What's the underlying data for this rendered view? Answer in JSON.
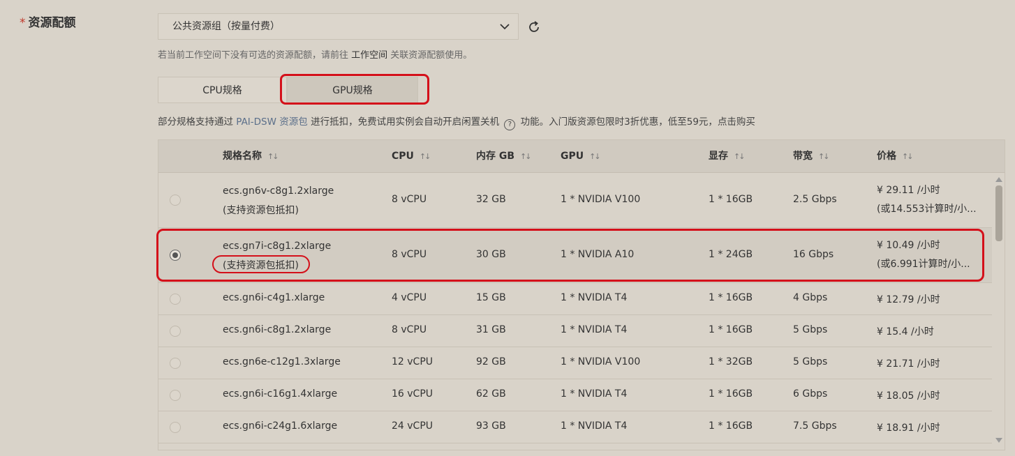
{
  "field": {
    "required_mark": "*",
    "label": "资源配额"
  },
  "select": {
    "value": "公共资源组（按量付费）"
  },
  "hint": {
    "before": "若当前工作空间下没有可选的资源配额，请前往 ",
    "link": "工作空间",
    "after": " 关联资源配额使用。"
  },
  "tabs": [
    {
      "label": "CPU规格"
    },
    {
      "label": "GPU规格"
    }
  ],
  "note": {
    "part1": "部分规格支持通过 ",
    "link1": "PAI-DSW 资源包",
    "part2": " 进行抵扣，免费试用实例会自动开启闲置关机 ",
    "help_icon": "?",
    "part3": " 功能。入门版资源包限时3折优惠，低至59元，",
    "link2": "点击购买"
  },
  "table": {
    "sort_glyph": "↑↓",
    "headers": [
      "规格名称",
      "CPU",
      "内存 GB",
      "GPU",
      "显存",
      "带宽",
      "价格"
    ],
    "rows": [
      {
        "name": "ecs.gn6v-c8g1.2xlarge",
        "sub": "(支持资源包抵扣)",
        "cpu": "8 vCPU",
        "mem": "32 GB",
        "gpu": "1 * NVIDIA V100",
        "vram": "1 * 16GB",
        "bw": "2.5 Gbps",
        "price": "¥ 29.11 /小时",
        "price_sub": "(或14.553计算时/小...",
        "selected": false
      },
      {
        "name": "ecs.gn7i-c8g1.2xlarge",
        "sub": "(支持资源包抵扣)",
        "cpu": "8 vCPU",
        "mem": "30 GB",
        "gpu": "1 * NVIDIA A10",
        "vram": "1 * 24GB",
        "bw": "16 Gbps",
        "price": "¥ 10.49 /小时",
        "price_sub": "(或6.991计算时/小...",
        "selected": true
      },
      {
        "name": "ecs.gn6i-c4g1.xlarge",
        "cpu": "4 vCPU",
        "mem": "15 GB",
        "gpu": "1 * NVIDIA T4",
        "vram": "1 * 16GB",
        "bw": "4 Gbps",
        "price": "¥ 12.79 /小时",
        "selected": false
      },
      {
        "name": "ecs.gn6i-c8g1.2xlarge",
        "cpu": "8 vCPU",
        "mem": "31 GB",
        "gpu": "1 * NVIDIA T4",
        "vram": "1 * 16GB",
        "bw": "5 Gbps",
        "price": "¥ 15.4 /小时",
        "selected": false
      },
      {
        "name": "ecs.gn6e-c12g1.3xlarge",
        "cpu": "12 vCPU",
        "mem": "92 GB",
        "gpu": "1 * NVIDIA V100",
        "vram": "1 * 32GB",
        "bw": "5 Gbps",
        "price": "¥ 21.71 /小时",
        "selected": false
      },
      {
        "name": "ecs.gn6i-c16g1.4xlarge",
        "cpu": "16 vCPU",
        "mem": "62 GB",
        "gpu": "1 * NVIDIA T4",
        "vram": "1 * 16GB",
        "bw": "6 Gbps",
        "price": "¥ 18.05 /小时",
        "selected": false
      },
      {
        "name": "ecs.gn6i-c24g1.6xlarge",
        "cpu": "24 vCPU",
        "mem": "93 GB",
        "gpu": "1 * NVIDIA T4",
        "vram": "1 * 16GB",
        "bw": "7.5 Gbps",
        "price": "¥ 18.91 /小时",
        "selected": false
      }
    ]
  },
  "colors": {
    "highlight": "#d4101a",
    "link": "#5b6f8a"
  }
}
